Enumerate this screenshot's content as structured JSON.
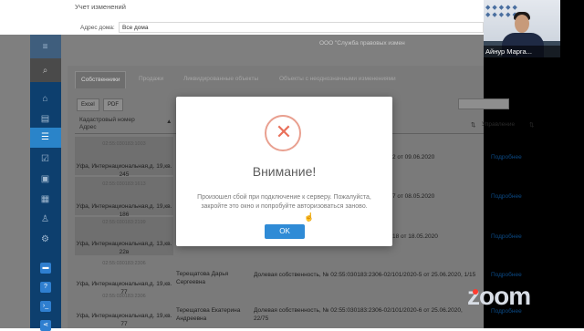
{
  "app": {
    "page_title": "Учет изменений",
    "address_label": "Адрес дома:",
    "address_value": "Все дома",
    "company": "ООО \"Служба правовых измен"
  },
  "tabs": [
    {
      "label": "Собственники"
    },
    {
      "label": "Продажи"
    },
    {
      "label": "Ликвидированные объекты"
    },
    {
      "label": "Объекты с неоднозначными изменениями"
    }
  ],
  "toolbar": {
    "excel": "Excel",
    "pdf": "PDF"
  },
  "table": {
    "col_cad_address": "Кадастровый номер Адрес",
    "col_manage": "Управление",
    "rows": [
      {
        "cad": "02:55:030183:1003",
        "addr": "Уфа, Интернациональная,д. 19,кв. 245",
        "right": "2 от 09.06.2020",
        "more": "Подробнее"
      },
      {
        "cad": "02:55:030183:1613",
        "addr": "Уфа, Интернациональная,д. 19,кв. 186",
        "right": "7 от 08.05.2020",
        "more": "Подробнее"
      },
      {
        "cad": "02:55:030183:2199",
        "addr": "Уфа, Интернациональная,д. 13,кв. 22в",
        "right": "18 от 18.05.2020",
        "more": "Подробнее"
      },
      {
        "cad": "02:55:030183:2306",
        "addr": "Уфа, Интернациональная,д. 19,кв. 77",
        "owner": "Терещатова Дарья Сергеевна",
        "right": "Долевая собственность, № 02:55:030183:2306-02/101/2020-5 от 25.06.2020, 1/15",
        "more": "Подробнее"
      },
      {
        "cad": "02:55:030183:2306",
        "addr": "Уфа, Интернациональная,д. 19,кв. 77",
        "owner": "Терещатова Екатерина Андреевна",
        "right": "Долевая собственность, № 02:55:030183:2306-02/101/2020-6 от 25.06.2020, 22/75",
        "more": "Подробнее"
      }
    ]
  },
  "dialog": {
    "title": "Внимание!",
    "message": "Произошел сбой при подключение к серверу. Пожалуйста, закройте это окно и попробуйте авторизоваться заново.",
    "ok": "OK"
  },
  "video": {
    "participant_name": "Айнур Марга...",
    "zoom_logo": "zoom"
  },
  "colors": {
    "sidebar": "#0d3f6e",
    "accent": "#2f8bd6",
    "error": "#e9705a"
  }
}
